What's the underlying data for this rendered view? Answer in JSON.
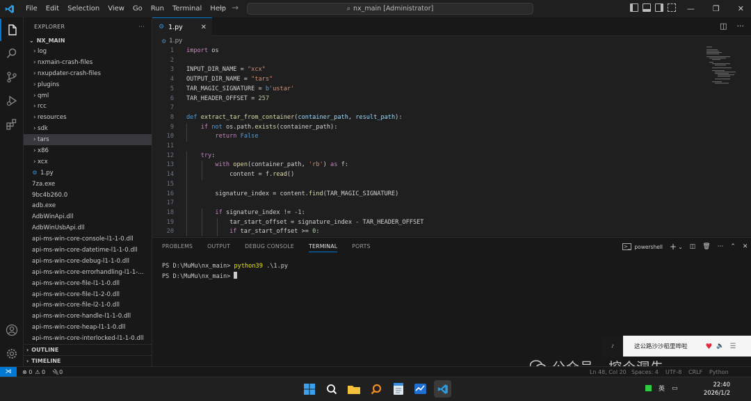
{
  "menu": [
    "File",
    "Edit",
    "Selection",
    "View",
    "Go",
    "Run",
    "Terminal",
    "Help"
  ],
  "command_center": "nx_main [Administrator]",
  "explorer": {
    "header": "EXPLORER",
    "more": "···",
    "root": "NX_MAIN",
    "folders": [
      "log",
      "nxmain-crash-files",
      "nxupdater-crash-files",
      "plugins",
      "qml",
      "rcc",
      "resources",
      "sdk",
      "tars",
      "x86",
      "xcx"
    ],
    "files": [
      "1.py",
      "7za.exe",
      "9bc4b260.0",
      "adb.exe",
      "AdbWinApi.dll",
      "AdbWinUsbApi.dll",
      "api-ms-win-core-console-l1-1-0.dll",
      "api-ms-win-core-datetime-l1-1-0.dll",
      "api-ms-win-core-debug-l1-1-0.dll",
      "api-ms-win-core-errorhandling-l1-1-...",
      "api-ms-win-core-file-l1-1-0.dll",
      "api-ms-win-core-file-l1-2-0.dll",
      "api-ms-win-core-file-l2-1-0.dll",
      "api-ms-win-core-handle-l1-1-0.dll",
      "api-ms-win-core-heap-l1-1-0.dll",
      "api-ms-win-core-interlocked-l1-1-0.dll"
    ],
    "selected_folder": "tars",
    "outline": "OUTLINE",
    "timeline": "TIMELINE"
  },
  "tab": {
    "name": "1.py",
    "close": "✕"
  },
  "breadcrumb": "1.py",
  "code_lines": [
    [
      [
        "kc",
        "import"
      ],
      [
        "df",
        " os"
      ]
    ],
    [],
    [
      [
        "df",
        "INPUT_DIR_NAME = "
      ],
      [
        "st",
        "\"xcx\""
      ]
    ],
    [
      [
        "df",
        "OUTPUT_DIR_NAME = "
      ],
      [
        "st",
        "\"tars\""
      ]
    ],
    [
      [
        "df",
        "TAR_MAGIC_SIGNATURE = "
      ],
      [
        "kw",
        "b"
      ],
      [
        "st",
        "'ustar'"
      ]
    ],
    [
      [
        "df",
        "TAR_HEADER_OFFSET = "
      ],
      [
        "nm",
        "257"
      ]
    ],
    [],
    [
      [
        "kw",
        "def"
      ],
      [
        "df",
        " "
      ],
      [
        "fn",
        "extract_tar_from_container"
      ],
      [
        "df",
        "("
      ],
      [
        "vr",
        "container_path"
      ],
      [
        "df",
        ", "
      ],
      [
        "vr",
        "result_path"
      ],
      [
        "df",
        "):"
      ]
    ],
    [
      [
        "df",
        "    "
      ],
      [
        "kc",
        "if"
      ],
      [
        "df",
        " "
      ],
      [
        "kw",
        "not"
      ],
      [
        "df",
        " os.path."
      ],
      [
        "fn",
        "exists"
      ],
      [
        "df",
        "(container_path):"
      ]
    ],
    [
      [
        "df",
        "        "
      ],
      [
        "kc",
        "return"
      ],
      [
        "df",
        " "
      ],
      [
        "kw",
        "False"
      ]
    ],
    [],
    [
      [
        "df",
        "    "
      ],
      [
        "kc",
        "try"
      ],
      [
        "df",
        ":"
      ]
    ],
    [
      [
        "df",
        "        "
      ],
      [
        "kc",
        "with"
      ],
      [
        "df",
        " "
      ],
      [
        "fn",
        "open"
      ],
      [
        "df",
        "(container_path, "
      ],
      [
        "st",
        "'rb'"
      ],
      [
        "df",
        ") "
      ],
      [
        "kc",
        "as"
      ],
      [
        "df",
        " f:"
      ]
    ],
    [
      [
        "df",
        "            content = f."
      ],
      [
        "fn",
        "read"
      ],
      [
        "df",
        "()"
      ]
    ],
    [],
    [
      [
        "df",
        "        signature_index = content."
      ],
      [
        "fn",
        "find"
      ],
      [
        "df",
        "(TAR_MAGIC_SIGNATURE)"
      ]
    ],
    [],
    [
      [
        "df",
        "        "
      ],
      [
        "kc",
        "if"
      ],
      [
        "df",
        " signature_index != "
      ],
      [
        "nm",
        "-1"
      ],
      [
        "df",
        ":"
      ]
    ],
    [
      [
        "df",
        "            tar_start_offset = signature_index - TAR_HEADER_OFFSET"
      ]
    ],
    [
      [
        "df",
        "            "
      ],
      [
        "kc",
        "if"
      ],
      [
        "df",
        " tar_start_offset >= "
      ],
      [
        "nm",
        "0"
      ],
      [
        "df",
        ":"
      ]
    ]
  ],
  "panel": {
    "tabs": [
      "PROBLEMS",
      "OUTPUT",
      "DEBUG CONSOLE",
      "TERMINAL",
      "PORTS"
    ],
    "active": "TERMINAL",
    "shell": "powershell"
  },
  "terminal": {
    "prompt1": "PS D:\\MuMu\\nx_main> ",
    "cmd": "python39",
    "args": " .\\1.py",
    "prompt2": "PS D:\\MuMu\\nx_main> "
  },
  "status": {
    "errors": "⊗ 0",
    "warnings": "⚠ 0",
    "ports": "🔌0",
    "position": "Ln 48, Col 20",
    "spaces": "Spaces: 4",
    "encoding": "UTF-8",
    "eol": "CRLF",
    "language": "Python"
  },
  "music": {
    "title": "这公路沙沙稻里哗啦"
  },
  "watermark": {
    "text": "公众号 · 挖个洞先"
  },
  "taskbar": {
    "time": "22:40",
    "date": "2026/1/2",
    "ime": "英"
  },
  "colors": {
    "accent": "#0078d4",
    "editor_bg": "#1f1f1f",
    "chrome_bg": "#181818"
  }
}
